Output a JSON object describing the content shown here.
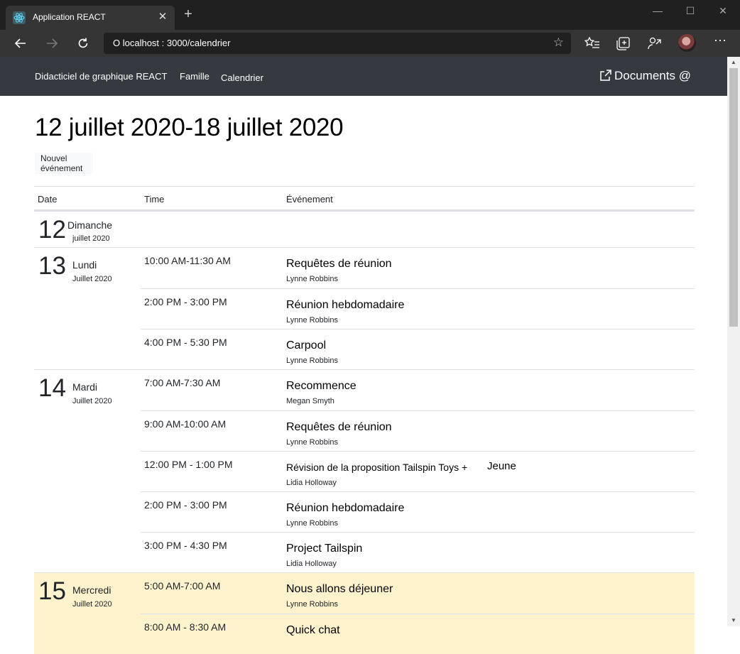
{
  "browser": {
    "tab_title": "Application REACT",
    "tab_close": "✕",
    "new_tab": "+",
    "url": "O localhost : 3000/calendrier",
    "win_minimize": "—",
    "win_maximize": "☐",
    "win_close": "✕",
    "icons": [
      "back-icon",
      "forward-icon",
      "refresh-icon",
      "favorite-star-icon",
      "favorites-icon",
      "collections-icon",
      "share-icon",
      "profile-avatar",
      "more-icon"
    ]
  },
  "app": {
    "brand": "Didacticiel de graphique REACT",
    "nav_links": [
      "Famille",
      "Calendrier"
    ],
    "docs_link": "Documents @"
  },
  "page": {
    "title": "12 juillet 2020-18 juillet 2020",
    "new_event_button": "Nouvel événement",
    "table_headers": [
      "Date",
      "Time",
      "Événement"
    ]
  },
  "days": [
    {
      "num": "12",
      "name": "Dimanche",
      "month": "juillet 2020",
      "today": false,
      "events": []
    },
    {
      "num": "13",
      "name": "Lundi",
      "month": "Juillet 2020",
      "today": false,
      "events": [
        {
          "time": "10:00 AM-11:30 AM",
          "subject": "Requêtes de réunion",
          "organizer": "Lynne Robbins"
        },
        {
          "time": "2:00 PM - 3:00 PM",
          "subject": "Réunion hebdomadaire",
          "organizer": "Lynne Robbins"
        },
        {
          "time": "4:00 PM - 5:30 PM",
          "subject": "Carpool",
          "organizer": "Lynne Robbins"
        }
      ]
    },
    {
      "num": "14",
      "name": "Mardi",
      "month": "Juillet 2020",
      "today": false,
      "events": [
        {
          "time": "7:00 AM-7:30 AM",
          "subject": "Recommence",
          "organizer": "Megan Smyth"
        },
        {
          "time": "9:00 AM-10:00 AM",
          "subject": "Requêtes de réunion",
          "organizer": "Lynne Robbins"
        },
        {
          "time": "12:00 PM - 1:00 PM",
          "subject": "Révision de la proposition Tailspin Toys +",
          "subject_extra": "Jeune",
          "organizer": "Lidia Holloway"
        },
        {
          "time": "2:00 PM - 3:00 PM",
          "subject": "Réunion hebdomadaire",
          "organizer": "Lynne Robbins"
        },
        {
          "time": "3:00 PM - 4:30 PM",
          "subject": "Project Tailspin",
          "organizer": "Lidia Holloway"
        }
      ]
    },
    {
      "num": "15",
      "name": "Mercredi",
      "month": "Juillet 2020",
      "today": true,
      "events": [
        {
          "time": "5:00 AM-7:00 AM",
          "subject": "Nous allons déjeuner",
          "organizer": "Lynne Robbins"
        },
        {
          "time": "8:00 AM - 8:30 AM",
          "subject": "Quick chat",
          "organizer": ""
        }
      ]
    }
  ],
  "colors": {
    "navbar": "#343a40",
    "today_highlight": "#fff3cd",
    "chrome_dark": "#202020",
    "chrome_tab": "#353535"
  }
}
